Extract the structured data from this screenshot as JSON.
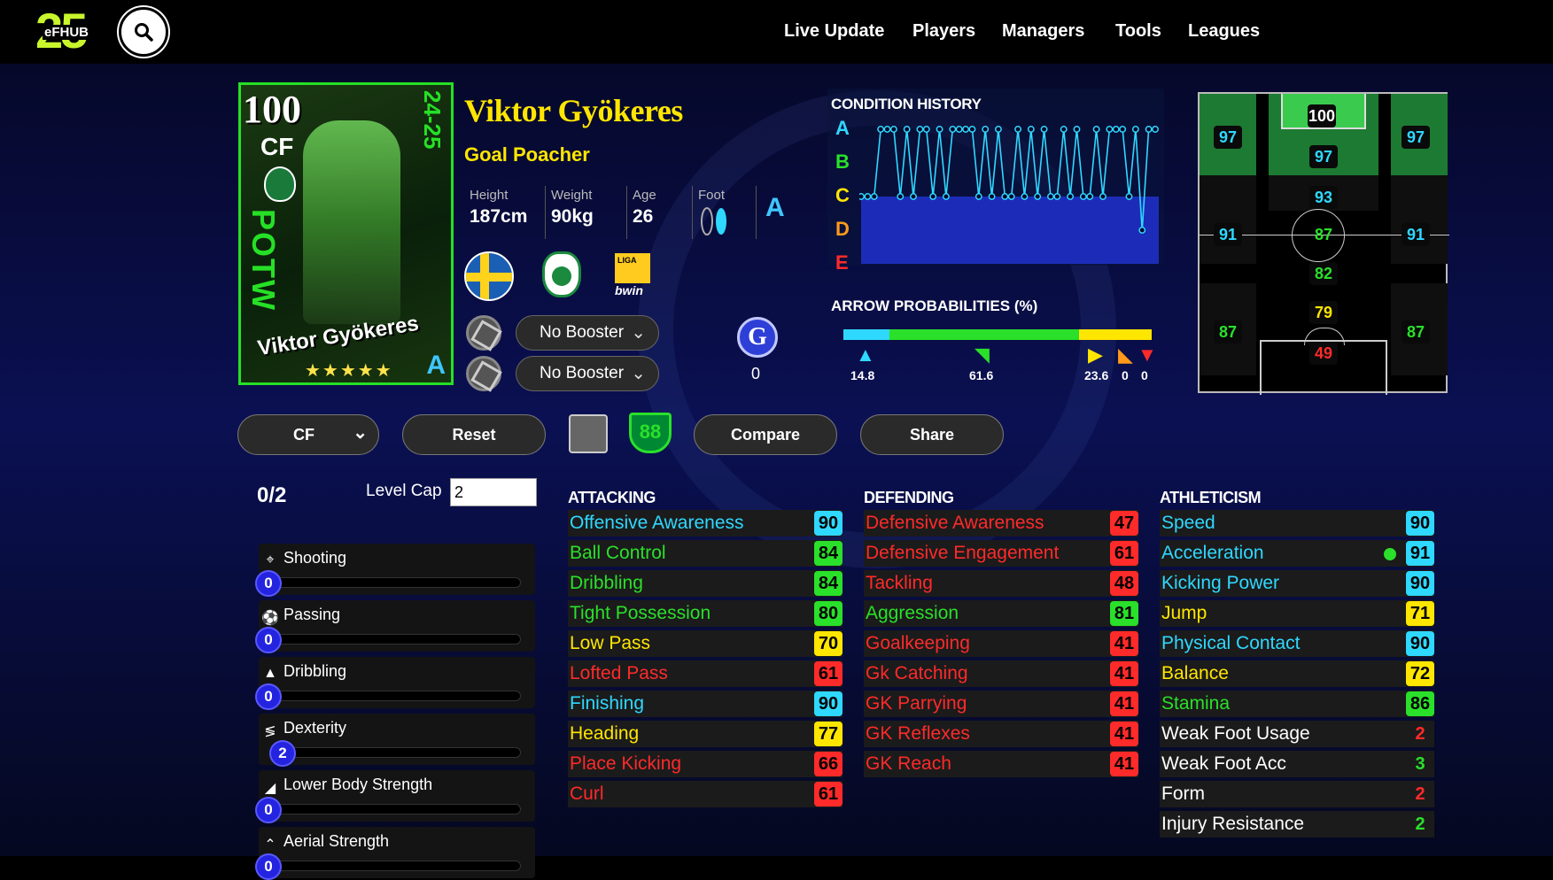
{
  "nav": {
    "logo_number": "25",
    "logo_text": "eFHUB",
    "links": [
      "Live Update",
      "Players",
      "Managers",
      "Tools",
      "Leagues"
    ]
  },
  "card": {
    "ovr": "100",
    "position": "CF",
    "potw": "POTW",
    "season": "24-25",
    "name": "Viktor Gyökeres",
    "stars": "★★★★★",
    "grade": "A"
  },
  "player": {
    "name": "Viktor Gyökeres",
    "style": "Goal Poacher",
    "height_label": "Height",
    "height": "187cm",
    "weight_label": "Weight",
    "weight": "90kg",
    "age_label": "Age",
    "age": "26",
    "foot_label": "Foot",
    "condition": "A"
  },
  "badges": {
    "league_line1": "LIGA",
    "league_line2": "bwin"
  },
  "boosters": [
    "No Booster",
    "No Booster"
  ],
  "g_count": "0",
  "condition_history": {
    "title": "CONDITION HISTORY",
    "grades": [
      {
        "g": "A",
        "color": "#2fd8ff"
      },
      {
        "g": "B",
        "color": "#2ae02a"
      },
      {
        "g": "C",
        "color": "#ffe600"
      },
      {
        "g": "D",
        "color": "#ff9a1a"
      },
      {
        "g": "E",
        "color": "#ff2a2a"
      }
    ],
    "levels": [
      "C",
      "C",
      "C",
      "A",
      "A",
      "A",
      "C",
      "A",
      "C",
      "A",
      "A",
      "C",
      "A",
      "C",
      "A",
      "A",
      "A",
      "A",
      "C",
      "A",
      "C",
      "A",
      "C",
      "C",
      "A",
      "C",
      "A",
      "C",
      "A",
      "C",
      "C",
      "A",
      "C",
      "A",
      "C",
      "C",
      "A",
      "C",
      "A",
      "A",
      "A",
      "C",
      "A",
      "D",
      "A",
      "A"
    ]
  },
  "arrow_probabilities": {
    "title": "ARROW PROBABILITIES (%)",
    "values": [
      "14.8",
      "61.6",
      "23.6",
      "0",
      "0"
    ],
    "segments": [
      {
        "pct": 14.8,
        "color": "#2fd8ff"
      },
      {
        "pct": 61.6,
        "color": "#2ae02a"
      },
      {
        "pct": 23.6,
        "color": "#ffe600"
      }
    ]
  },
  "pitch": {
    "ratings": [
      {
        "v": "100",
        "color": "#ffffff"
      },
      {
        "v": "97",
        "color": "#2fd8ff"
      },
      {
        "v": "97",
        "color": "#2fd8ff"
      },
      {
        "v": "97",
        "color": "#2fd8ff"
      },
      {
        "v": "93",
        "color": "#2fd8ff"
      },
      {
        "v": "91",
        "color": "#2fd8ff"
      },
      {
        "v": "87",
        "color": "#2ae02a"
      },
      {
        "v": "91",
        "color": "#2fd8ff"
      },
      {
        "v": "82",
        "color": "#2ae02a"
      },
      {
        "v": "87",
        "color": "#2ae02a"
      },
      {
        "v": "79",
        "color": "#ffe600"
      },
      {
        "v": "87",
        "color": "#2ae02a"
      },
      {
        "v": "49",
        "color": "#ff2a2a"
      }
    ]
  },
  "actions": {
    "position_select": "CF",
    "reset": "Reset",
    "manager_ovr": "88",
    "compare": "Compare",
    "share": "Share"
  },
  "progression": {
    "points": "0/2",
    "level_cap_label": "Level Cap",
    "level_cap_value": "2",
    "skills": [
      {
        "name": "Shooting",
        "icon": "⌖",
        "val": "0"
      },
      {
        "name": "Passing",
        "icon": "⚽",
        "val": "0"
      },
      {
        "name": "Dribbling",
        "icon": "▲",
        "val": "0"
      },
      {
        "name": "Dexterity",
        "icon": "≶",
        "val": "2"
      },
      {
        "name": "Lower Body Strength",
        "icon": "◢",
        "val": "0"
      },
      {
        "name": "Aerial Strength",
        "icon": "⌃",
        "val": "0"
      }
    ]
  },
  "stats": {
    "attacking": {
      "title": "ATTACKING",
      "items": [
        {
          "n": "Offensive Awareness",
          "v": "90",
          "c": "#2fd8ff"
        },
        {
          "n": "Ball Control",
          "v": "84",
          "c": "#2ae02a"
        },
        {
          "n": "Dribbling",
          "v": "84",
          "c": "#2ae02a"
        },
        {
          "n": "Tight Possession",
          "v": "80",
          "c": "#2ae02a"
        },
        {
          "n": "Low Pass",
          "v": "70",
          "c": "#ffe600"
        },
        {
          "n": "Lofted Pass",
          "v": "61",
          "c": "#ff2a2a"
        },
        {
          "n": "Finishing",
          "v": "90",
          "c": "#2fd8ff"
        },
        {
          "n": "Heading",
          "v": "77",
          "c": "#ffe600"
        },
        {
          "n": "Place Kicking",
          "v": "66",
          "c": "#ff2a2a"
        },
        {
          "n": "Curl",
          "v": "61",
          "c": "#ff2a2a"
        }
      ]
    },
    "defending": {
      "title": "DEFENDING",
      "items": [
        {
          "n": "Defensive Awareness",
          "v": "47",
          "c": "#ff2a2a"
        },
        {
          "n": "Defensive Engagement",
          "v": "61",
          "c": "#ff2a2a"
        },
        {
          "n": "Tackling",
          "v": "48",
          "c": "#ff2a2a"
        },
        {
          "n": "Aggression",
          "v": "81",
          "c": "#2ae02a"
        },
        {
          "n": "Goalkeeping",
          "v": "41",
          "c": "#ff2a2a"
        },
        {
          "n": "Gk Catching",
          "v": "41",
          "c": "#ff2a2a"
        },
        {
          "n": "GK Parrying",
          "v": "41",
          "c": "#ff2a2a"
        },
        {
          "n": "GK Reflexes",
          "v": "41",
          "c": "#ff2a2a"
        },
        {
          "n": "GK Reach",
          "v": "41",
          "c": "#ff2a2a"
        }
      ]
    },
    "athleticism": {
      "title": "ATHLETICISM",
      "items": [
        {
          "n": "Speed",
          "v": "90",
          "c": "#2fd8ff"
        },
        {
          "n": "Acceleration",
          "v": "91",
          "c": "#2fd8ff"
        },
        {
          "n": "Kicking Power",
          "v": "90",
          "c": "#2fd8ff"
        },
        {
          "n": "Jump",
          "v": "71",
          "c": "#ffe600"
        },
        {
          "n": "Physical Contact",
          "v": "90",
          "c": "#2fd8ff"
        },
        {
          "n": "Balance",
          "v": "72",
          "c": "#ffe600"
        },
        {
          "n": "Stamina",
          "v": "86",
          "c": "#2ae02a"
        },
        {
          "n": "Weak Foot Usage",
          "v": "2",
          "c": "#ffffff",
          "vc": "#ff2a2a",
          "plain": true
        },
        {
          "n": "Weak Foot Acc",
          "v": "3",
          "c": "#ffffff",
          "vc": "#2ae02a",
          "plain": true
        },
        {
          "n": "Form",
          "v": "2",
          "c": "#ffffff",
          "vc": "#ff2a2a",
          "plain": true
        },
        {
          "n": "Injury Resistance",
          "v": "2",
          "c": "#ffffff",
          "vc": "#2ae02a",
          "plain": true
        }
      ]
    }
  }
}
